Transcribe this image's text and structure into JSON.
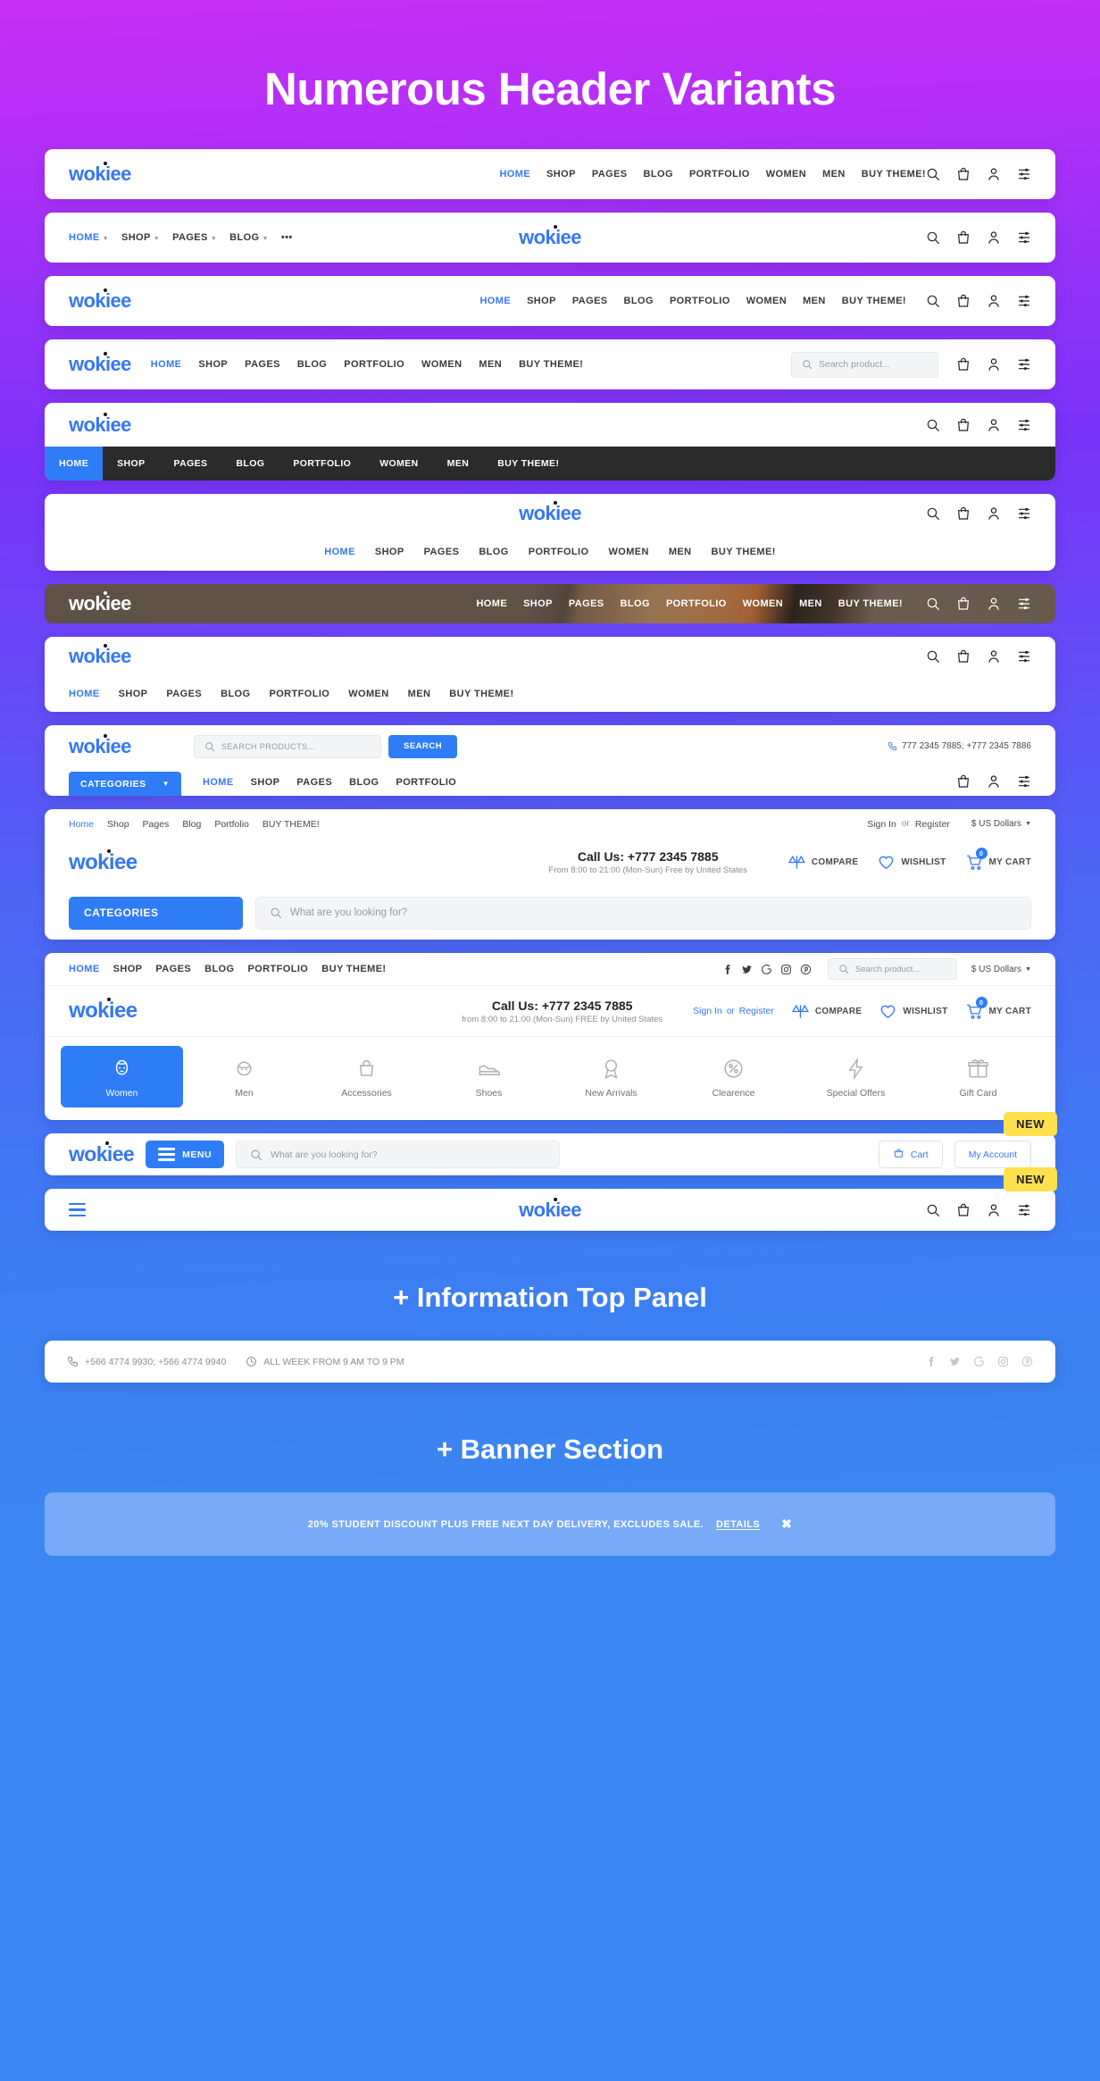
{
  "hero": {
    "title": "Numerous Header Variants"
  },
  "sections": {
    "info_panel_title": "+ Information Top Panel",
    "banner_title": "+ Banner Section"
  },
  "brand": {
    "logo": "wokiee"
  },
  "main_menu": [
    "HOME",
    "SHOP",
    "PAGES",
    "BLOG",
    "PORTFOLIO",
    "WOMEN",
    "MEN",
    "BUY THEME!"
  ],
  "mini_menu": [
    "HOME",
    "SHOP",
    "PAGES",
    "BLOG"
  ],
  "mini_menu_more": "•••",
  "lowercase_menu": [
    "Home",
    "Shop",
    "Pages",
    "Blog",
    "Portfolio",
    "BUY THEME!"
  ],
  "short_menu": [
    "HOME",
    "SHOP",
    "PAGES",
    "BLOG",
    "PORTFOLIO"
  ],
  "icons": {
    "search": "search-icon",
    "bag": "shopping-bag-icon",
    "user": "user-icon",
    "settings": "settings-sliders-icon"
  },
  "search": {
    "placeholder_product": "Search product...",
    "placeholder_products_caps": "SEARCH PRODUCTS...",
    "placeholder_looking": "What are you looking for?",
    "button_label": "SEARCH"
  },
  "header9": {
    "categories_label": "CATEGORIES",
    "phone": "777 2345 7885; +777 2345 7886"
  },
  "header10": {
    "signin": "Sign In",
    "or": "or",
    "register": "Register",
    "currency": "$ US Dollars",
    "call_big": "Call Us: +777 2345 7885",
    "call_small": "From 8:00 to 21:00 (Mon-Sun) Free by United States",
    "compare": "COMPARE",
    "wishlist": "WISHLIST",
    "cart": "MY CART",
    "cart_count": "0",
    "categories_label": "CATEGORIES"
  },
  "header11": {
    "call_big": "Call Us: +777 2345 7885",
    "call_small": "from 8:00 to 21:00 (Mon-Sun) FREE by United States",
    "signin": "Sign In",
    "or": "or",
    "register": "Register",
    "compare": "COMPARE",
    "wishlist": "WISHLIST",
    "cart": "MY CART",
    "cart_count": "0",
    "currency": "$ US Dollars",
    "socials": [
      "facebook-icon",
      "twitter-icon",
      "google-icon",
      "instagram-icon",
      "pinterest-icon"
    ],
    "categories": [
      {
        "label": "Women",
        "icon": "woman-face-icon",
        "selected": true
      },
      {
        "label": "Men",
        "icon": "man-face-icon",
        "selected": false
      },
      {
        "label": "Accessories",
        "icon": "handbag-icon",
        "selected": false
      },
      {
        "label": "Shoes",
        "icon": "shoe-icon",
        "selected": false
      },
      {
        "label": "New Arrivals",
        "icon": "ribbon-award-icon",
        "selected": false
      },
      {
        "label": "Clearence",
        "icon": "percent-tag-icon",
        "selected": false
      },
      {
        "label": "Special Offers",
        "icon": "lightning-bolt-icon",
        "selected": false
      },
      {
        "label": "Gift Card",
        "icon": "gift-icon",
        "selected": false
      }
    ]
  },
  "header12": {
    "menu_label": "MENU",
    "cart_label": "Cart",
    "account_label": "My Account",
    "new_badge": "NEW"
  },
  "header13": {
    "new_badge": "NEW"
  },
  "info_panel": {
    "phones": "+566 4774 9930; +566 4774 9940",
    "hours": "ALL WEEK FROM 9 AM TO 9 PM",
    "socials": [
      "facebook-icon",
      "twitter-icon",
      "google-icon",
      "instagram-icon",
      "pinterest-icon"
    ]
  },
  "banner": {
    "text": "20% STUDENT DISCOUNT PLUS FREE NEXT DAY DELIVERY, EXCLUDES SALE.",
    "link": "DETAILS",
    "close": "✖"
  },
  "colors": {
    "accent_blue": "#2f7df6",
    "logo_blue": "#3577f5",
    "badge_yellow": "#ffe14d",
    "dark_nav": "#2b2b2b",
    "banner_blue": "#78aaf7"
  }
}
